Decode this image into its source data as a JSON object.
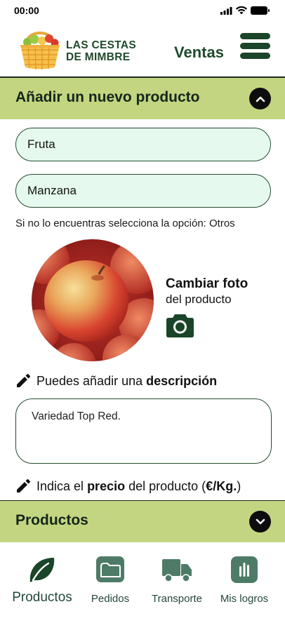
{
  "status_bar": {
    "time": "00:00"
  },
  "header": {
    "brand_line1": "LAS CESTAS",
    "brand_line2": "DE MIMBRE",
    "title": "Ventas"
  },
  "add_section": {
    "title": "Añadir un nuevo producto"
  },
  "form": {
    "category_value": "Fruta",
    "product_value": "Manzana",
    "hint": "Si no lo encuentras selecciona la opción: Otros",
    "change_photo_main": "Cambiar foto",
    "change_photo_sub": "del producto",
    "description_label_prefix": "Puedes añadir una",
    "description_label_bold": "descripción",
    "description_value": "Variedad Top Red.",
    "price_label_prefix": "Indica el",
    "price_label_bold": "precio",
    "price_label_mid": "del producto (",
    "price_label_unit": "€/Kg.",
    "price_label_end": ")"
  },
  "products_section": {
    "title": "Productos"
  },
  "bottom_nav": {
    "items": [
      {
        "label": "Productos",
        "icon": "leaf-icon",
        "active": true
      },
      {
        "label": "Pedidos",
        "icon": "folder-icon",
        "active": false
      },
      {
        "label": "Transporte",
        "icon": "truck-icon",
        "active": false
      },
      {
        "label": "Mis logros",
        "icon": "bar-chart-icon",
        "active": false
      }
    ]
  },
  "colors": {
    "brand_green": "#1a4529",
    "section_bar": "#c4d581",
    "input_fill": "#e6f9ee",
    "nav_icon_bg": "#4e7b68"
  }
}
